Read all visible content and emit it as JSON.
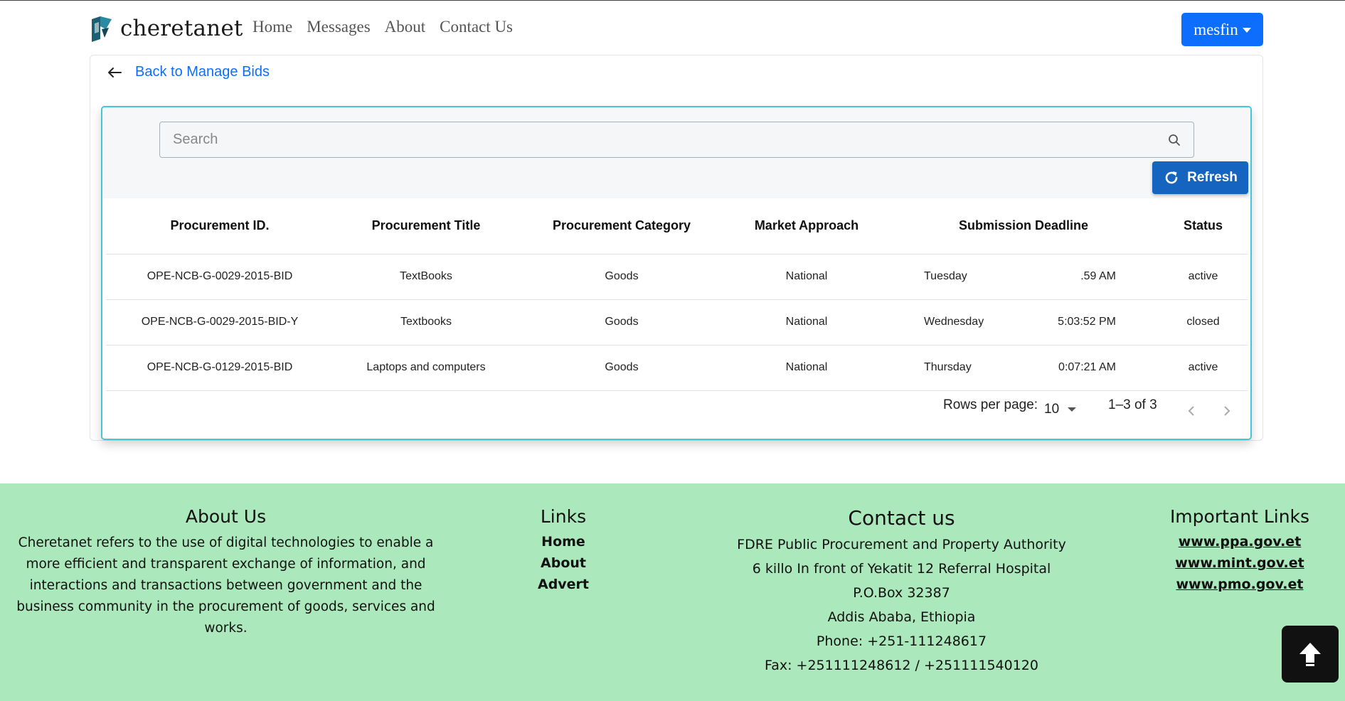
{
  "brand": {
    "name": "cheretanet"
  },
  "nav": {
    "links": [
      "Home",
      "Messages",
      "About",
      "Contact Us"
    ],
    "user": "mesfin"
  },
  "back": {
    "label": "Back to Manage Bids"
  },
  "search": {
    "placeholder": "Search",
    "value": ""
  },
  "refresh": {
    "label": "Refresh"
  },
  "table": {
    "headers": [
      "Procurement ID.",
      "Procurement Title",
      "Procurement Category",
      "Market Approach",
      "Submission Deadline",
      "Status"
    ],
    "rows": [
      {
        "id": "OPE-NCB-G-0029-2015-BID",
        "title": "TextBooks",
        "category": "Goods",
        "market": "National",
        "day": "Tuesday",
        "time": ".59 AM",
        "status": "active"
      },
      {
        "id": "OPE-NCB-G-0029-2015-BID-Y",
        "title": "Textbooks",
        "category": "Goods",
        "market": "National",
        "day": "Wednesday",
        "time": "5:03:52 PM",
        "status": "closed"
      },
      {
        "id": "OPE-NCB-G-0129-2015-BID",
        "title": "Laptops and computers",
        "category": "Goods",
        "market": "National",
        "day": "Thursday",
        "time": "0:07:21 AM",
        "status": "active"
      }
    ]
  },
  "pagination": {
    "rows_label": "Rows per page:",
    "rows_value": "10",
    "range": "1–3 of 3"
  },
  "footer": {
    "about": {
      "title": "About Us",
      "text": "Cheretanet refers to the use of digital technologies to enable a more efficient and transparent exchange of information, and interactions and transactions between government and the business community in the procurement of goods, services and works."
    },
    "links": {
      "title": "Links",
      "items": [
        "Home",
        "About",
        "Advert"
      ]
    },
    "contact": {
      "title": "Contact us",
      "lines": [
        "FDRE Public Procurement and Property Authority",
        "6 killo In front of Yekatit 12 Referral Hospital",
        "P.O.Box 32387",
        "Addis Ababa, Ethiopia",
        "Phone: +251-111248617",
        "Fax: +251111248612 / +251111540120"
      ]
    },
    "important": {
      "title": "Important Links",
      "items": [
        "www.ppa.gov.et",
        "www.mint.gov.et",
        "www.pmo.gov.et"
      ]
    }
  },
  "colors": {
    "primary": "#0d6efd",
    "refresh": "#1565c0",
    "panel_border": "#45c6d4",
    "footer_bg": "#abe9bc"
  }
}
